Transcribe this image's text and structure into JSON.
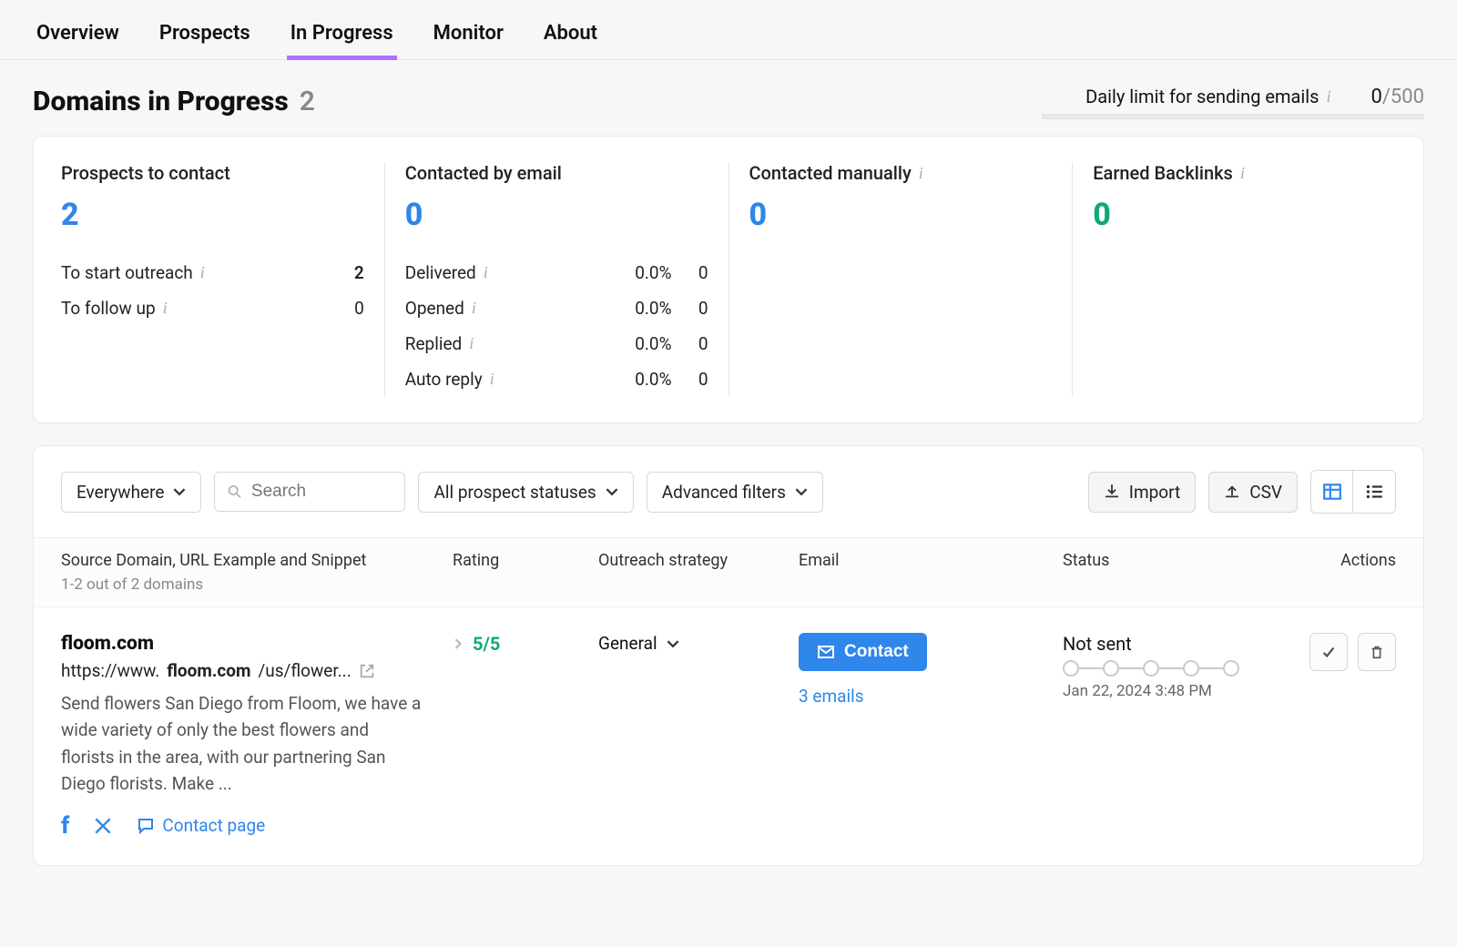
{
  "tabs": [
    "Overview",
    "Prospects",
    "In Progress",
    "Monitor",
    "About"
  ],
  "active_tab": 2,
  "page_title": "Domains in Progress",
  "page_count": "2",
  "limit": {
    "label": "Daily limit for sending emails",
    "used": "0",
    "total": "/500"
  },
  "stats": {
    "prospects": {
      "title": "Prospects to contact",
      "value": "2",
      "rows": [
        {
          "label": "To start outreach",
          "count": "2",
          "link": true
        },
        {
          "label": "To follow up",
          "count": "0"
        }
      ]
    },
    "email": {
      "title": "Contacted by email",
      "value": "0",
      "rows": [
        {
          "label": "Delivered",
          "pct": "0.0%",
          "count": "0"
        },
        {
          "label": "Opened",
          "pct": "0.0%",
          "count": "0"
        },
        {
          "label": "Replied",
          "pct": "0.0%",
          "count": "0"
        },
        {
          "label": "Auto reply",
          "pct": "0.0%",
          "count": "0"
        }
      ]
    },
    "manual": {
      "title": "Contacted manually",
      "value": "0"
    },
    "earned": {
      "title": "Earned Backlinks",
      "value": "0"
    }
  },
  "filters": {
    "scope": "Everywhere",
    "search_placeholder": "Search",
    "status": "All prospect statuses",
    "advanced": "Advanced filters",
    "import": "Import",
    "csv": "CSV"
  },
  "columns": {
    "source": "Source Domain, URL Example and Snippet",
    "source_sub": "1-2 out of 2 domains",
    "rating": "Rating",
    "strategy": "Outreach strategy",
    "email": "Email",
    "status": "Status",
    "actions": "Actions"
  },
  "row": {
    "domain": "floom.com",
    "url_pre": "https://www.",
    "url_bold": "floom.com",
    "url_post": "/us/flower...",
    "snippet": "Send flowers San Diego from Floom, we have a wide variety of only the best flowers and florists in the area, with our partnering San Diego florists. Make ...",
    "rating": "5/5",
    "strategy": "General",
    "contact": "Contact",
    "emails": "3 emails",
    "status": "Not sent",
    "timestamp": "Jan 22, 2024 3:48 PM",
    "contact_page": "Contact page"
  }
}
